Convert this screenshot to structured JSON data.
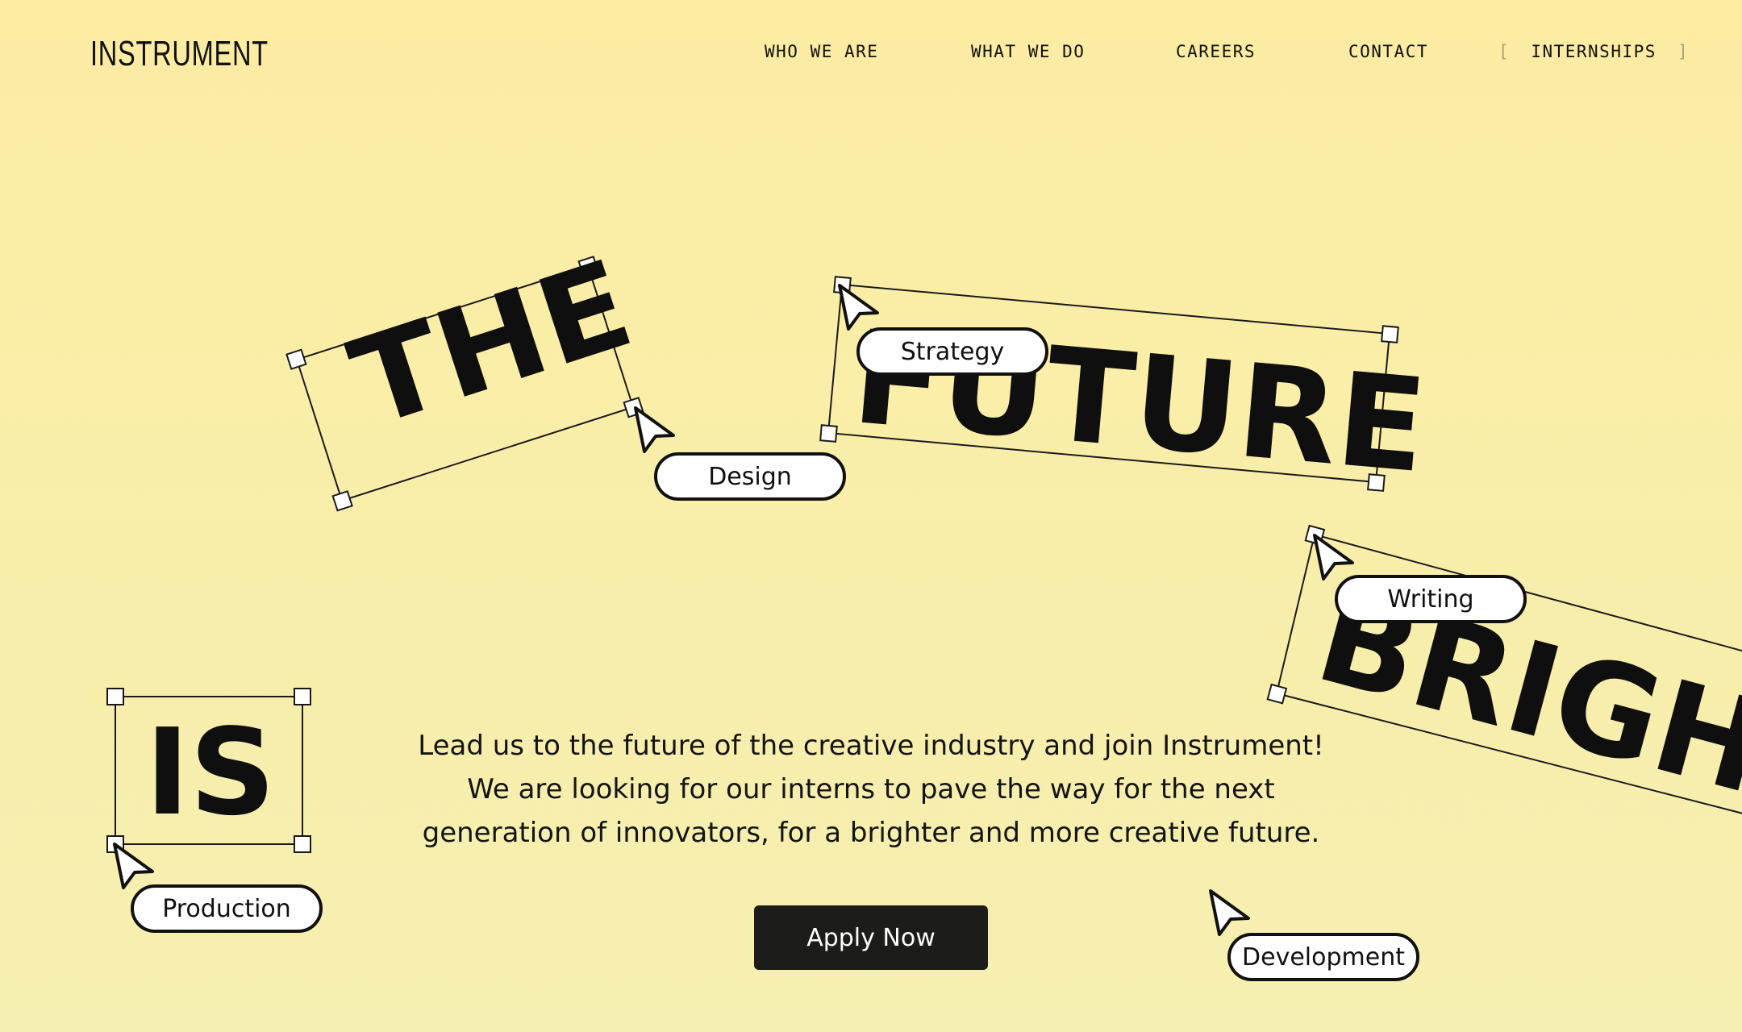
{
  "brand": {
    "logo": "INSTRUMENT"
  },
  "nav": {
    "items": [
      "WHO WE ARE",
      "WHAT WE DO",
      "CAREERS",
      "CONTACT"
    ],
    "highlight": {
      "open": "[",
      "label": "INTERNSHIPS",
      "close": "]"
    }
  },
  "hero": {
    "words": [
      "THE",
      "FUTURE",
      "IS",
      "BRIGHT"
    ],
    "tags": [
      "Design",
      "Strategy",
      "Writing",
      "Production",
      "Development"
    ]
  },
  "intro": {
    "lines": [
      "Lead us to the future of the creative industry and join Instrument!",
      "We are looking for our interns to pave the way for the next",
      "generation of innovators, for a brighter and more creative future."
    ]
  },
  "cta": {
    "label": "Apply Now"
  },
  "colors": {
    "background": "#fdeca2",
    "ink": "#111111",
    "button": "#1c1c19"
  }
}
